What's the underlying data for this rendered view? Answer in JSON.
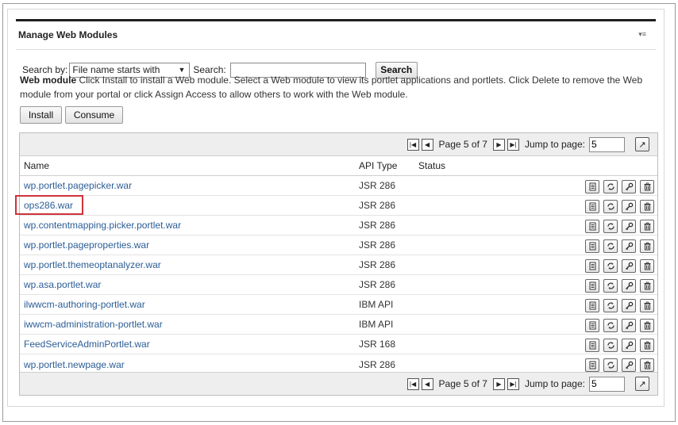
{
  "portlet": {
    "title": "Manage Web Modules",
    "menu_glyph": "▾≡"
  },
  "search": {
    "by_label": "Search by:",
    "by_selected": "File name starts with",
    "search_label": "Search:",
    "value": "",
    "button_label": "Search"
  },
  "help": {
    "heading": "Web module",
    "text": " Click Install to install a Web module. Select a Web module to view its portlet applications and portlets. Click Delete to remove the Web module from your portal or click Assign Access to allow others to work with the Web module."
  },
  "actions": {
    "install_label": "Install",
    "consume_label": "Consume"
  },
  "pager": {
    "page_text": "Page 5 of 7",
    "jump_label": "Jump to page:",
    "jump_value": "5"
  },
  "table": {
    "headers": {
      "name": "Name",
      "api": "API Type",
      "status": "Status"
    },
    "rows": [
      {
        "name": "wp.portlet.pagepicker.war",
        "api": "JSR 286"
      },
      {
        "name": "ops286.war",
        "api": "JSR 286"
      },
      {
        "name": "wp.contentmapping.picker.portlet.war",
        "api": "JSR 286"
      },
      {
        "name": "wp.portlet.pageproperties.war",
        "api": "JSR 286"
      },
      {
        "name": "wp.portlet.themeoptanalyzer.war",
        "api": "JSR 286"
      },
      {
        "name": "wp.asa.portlet.war",
        "api": "JSR 286"
      },
      {
        "name": "ilwwcm-authoring-portlet.war",
        "api": "IBM API"
      },
      {
        "name": "iwwcm-administration-portlet.war",
        "api": "IBM API"
      },
      {
        "name": "FeedServiceAdminPortlet.war",
        "api": "JSR 168"
      },
      {
        "name": "wp.portlet.newpage.war",
        "api": "JSR 286"
      }
    ]
  },
  "colors": {
    "link": "#2b5d95",
    "highlight": "#d0333a",
    "title_bar": "#1e1e1e"
  }
}
